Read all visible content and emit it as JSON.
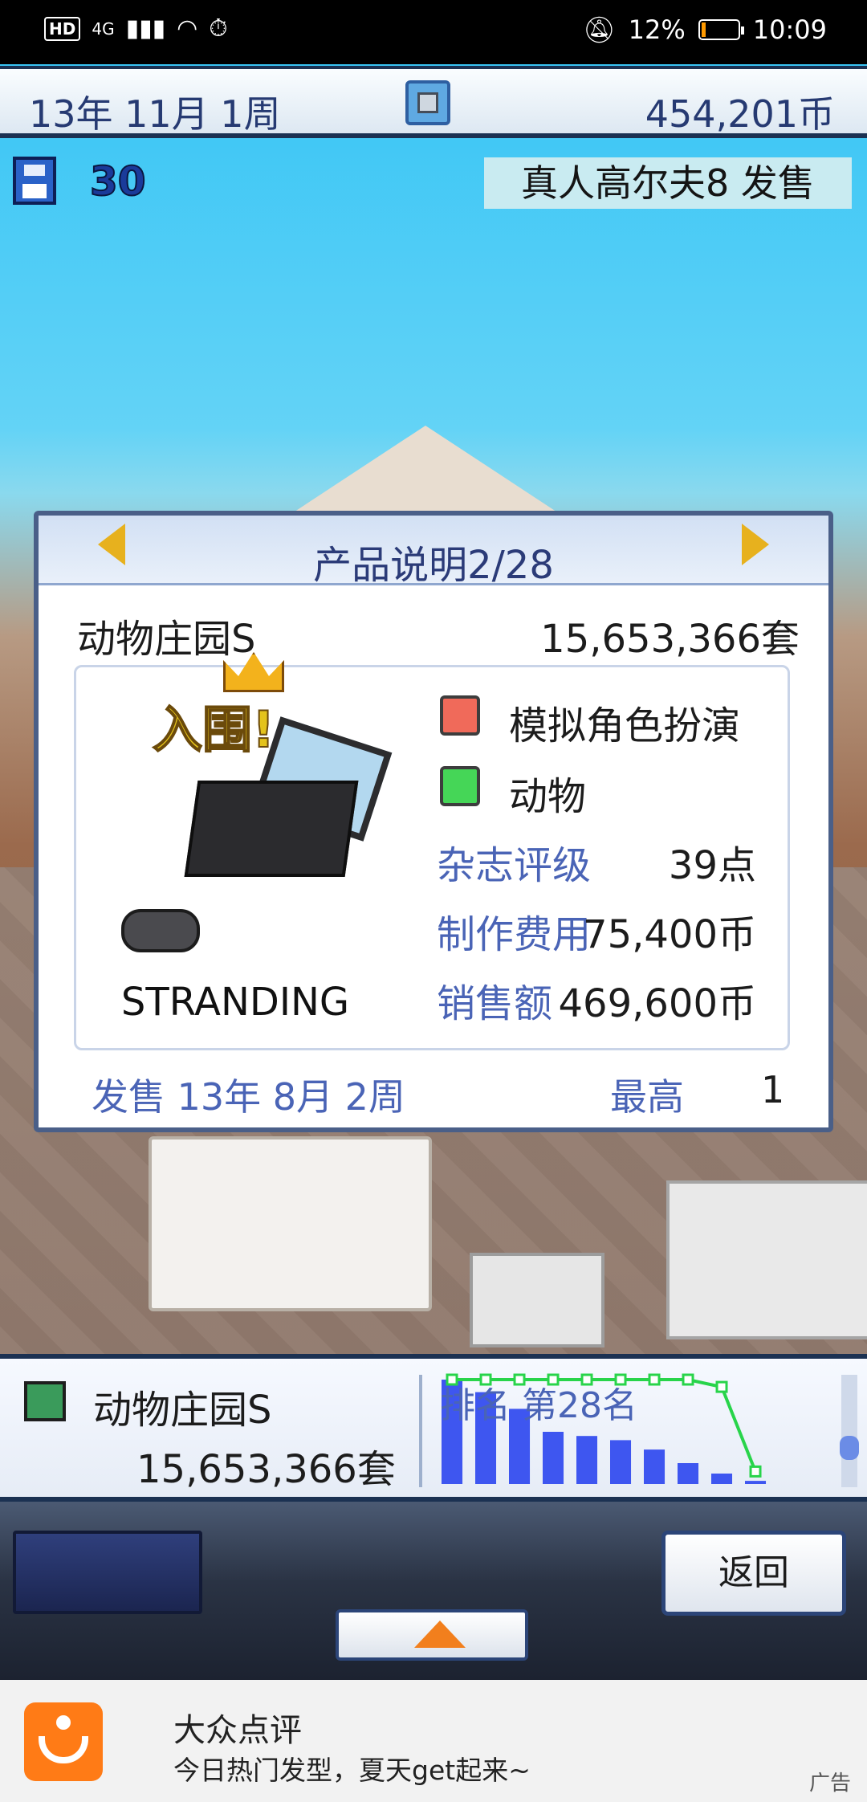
{
  "status_bar": {
    "network": "4G",
    "hd": "HD",
    "battery_text": "12%",
    "battery_level": 0.12,
    "time": "10:09"
  },
  "top_bar": {
    "date": "13年 11月 1周",
    "money": "454,201币",
    "save_count": "30",
    "release_banner": "真人高尔夫8 发售"
  },
  "dialog": {
    "title": "产品说明2/28",
    "product_name": "动物庄园S",
    "units_sold": "15,653,366套",
    "hall_of_fame": "入围!",
    "platform": "STRANDING",
    "genre": "模拟角色扮演",
    "theme": "动物",
    "rows": [
      {
        "label": "杂志评级",
        "value": "39点"
      },
      {
        "label": "制作费用",
        "value": "75,400币"
      },
      {
        "label": "销售额",
        "value": "469,600币"
      }
    ],
    "release": "发售 13年 8月 2周",
    "peak_label": "最高",
    "peak_value": "1"
  },
  "ranking_panel": {
    "name": "动物庄园S",
    "sales": "15,653,366套",
    "rank_text": "排名 第28名"
  },
  "controls": {
    "back_label": "返回"
  },
  "ad": {
    "title": "大众点评",
    "subtitle": "今日热门发型，夏天get起来~",
    "tag": "广告"
  },
  "chart_data": {
    "type": "bar",
    "bars": [
      1.0,
      0.88,
      0.72,
      0.5,
      0.46,
      0.42,
      0.33,
      0.2,
      0.1,
      0.03
    ],
    "line": [
      1,
      1,
      1,
      1,
      1,
      1,
      1,
      1,
      0.93,
      0.12
    ],
    "colors": {
      "bar": "#3e56f0",
      "line": "#28d44a"
    }
  }
}
